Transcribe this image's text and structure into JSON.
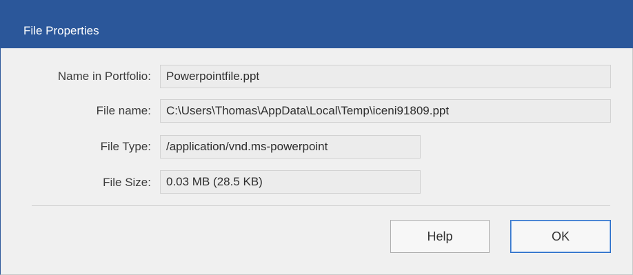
{
  "window": {
    "title": "File Properties"
  },
  "fields": {
    "name_in_portfolio": {
      "label": "Name in  Portfolio:",
      "value": "Powerpointfile.ppt"
    },
    "file_name": {
      "label": "File name:",
      "value": "C:\\Users\\Thomas\\AppData\\Local\\Temp\\iceni91809.ppt"
    },
    "file_type": {
      "label": "File Type:",
      "value": "/application/vnd.ms-powerpoint"
    },
    "file_size": {
      "label": "File Size:",
      "value": "0.03 MB (28.5 KB)"
    }
  },
  "buttons": {
    "help_label": "Help",
    "ok_label": "OK"
  },
  "colors": {
    "title_bar": "#2b579a",
    "background": "#f0f0f0",
    "field_background": "#ececec",
    "default_button_border": "#2b6fc9"
  }
}
